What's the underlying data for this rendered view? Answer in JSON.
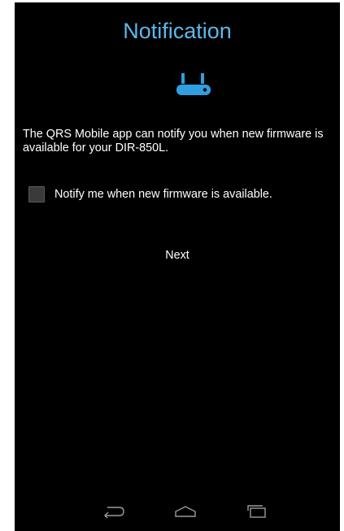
{
  "screen": {
    "title": "Notification",
    "description": "The QRS Mobile app can notify you when new firmware is available for your DIR-850L.",
    "checkbox": {
      "label": "Notify me when new firmware is available.",
      "checked": false
    },
    "next_label": "Next"
  },
  "icons": {
    "header": "router-icon",
    "nav": [
      "back-icon",
      "home-icon",
      "recent-apps-icon"
    ]
  },
  "colors": {
    "background": "#000000",
    "title": "#5db8ea",
    "icon": "#2f9fe0",
    "text": "#ffffff",
    "nav_icons": "#9a9a9a"
  }
}
